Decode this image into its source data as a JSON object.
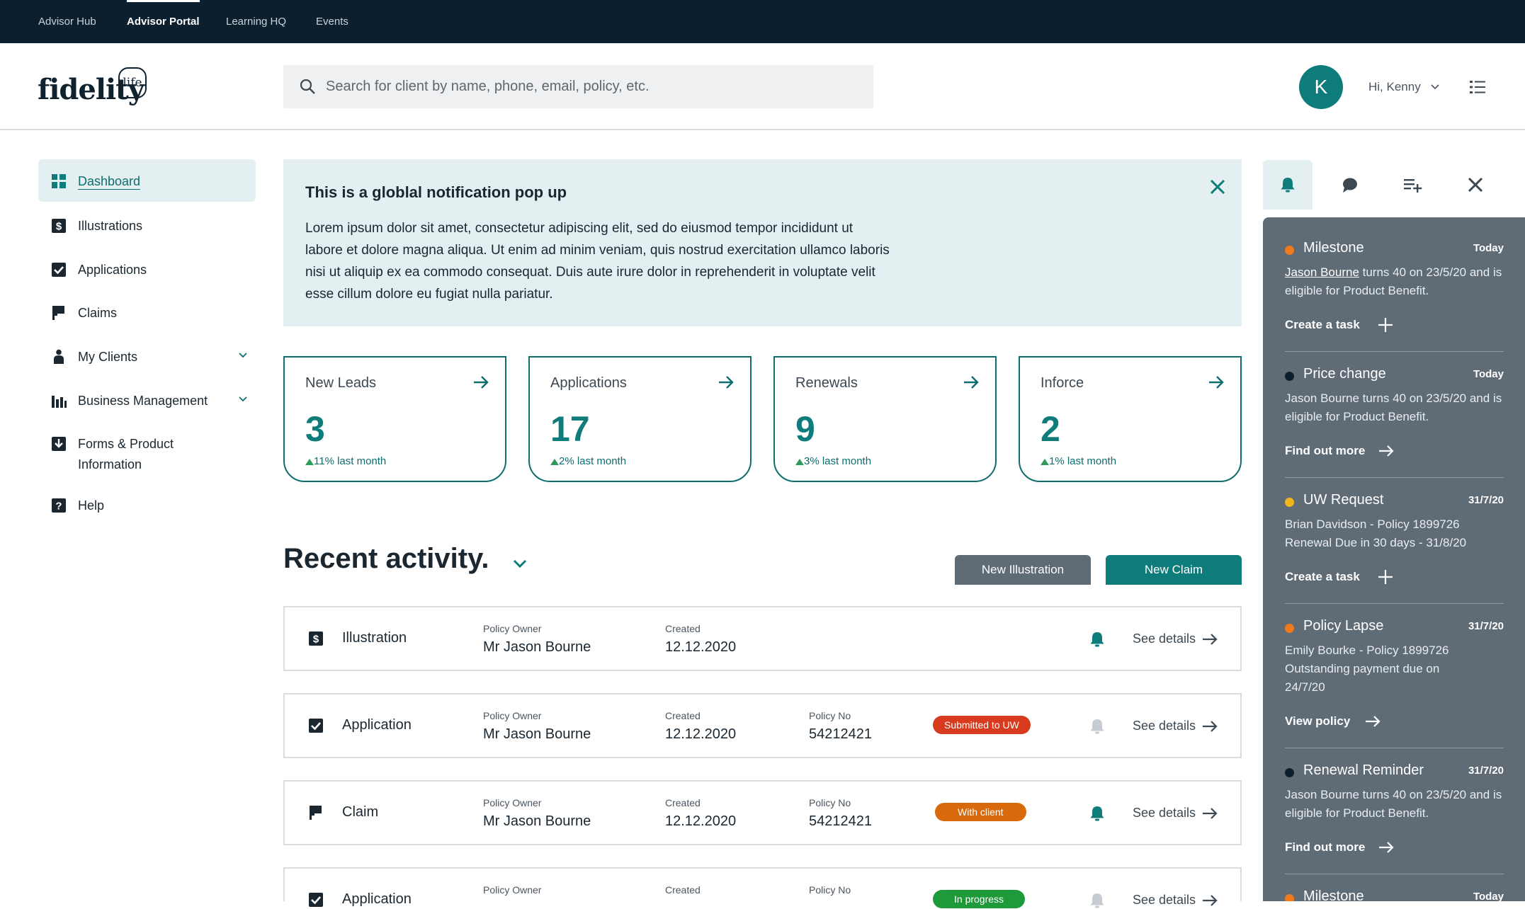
{
  "topnav": [
    {
      "label": "Advisor Hub",
      "active": false
    },
    {
      "label": "Advisor Portal",
      "active": true
    },
    {
      "label": "Learning HQ",
      "active": false
    },
    {
      "label": "Events",
      "active": false
    }
  ],
  "header": {
    "logo_text": "fidelity",
    "logo_badge": "life",
    "search_placeholder": "Search for client by name, phone, email, policy, etc.",
    "avatar_initial": "K",
    "greeting": "Hi, Kenny"
  },
  "sidebar": {
    "items": [
      {
        "label": "Dashboard",
        "icon": "dashboard-icon",
        "active": true
      },
      {
        "label": "Illustrations",
        "icon": "dollar-icon"
      },
      {
        "label": "Applications",
        "icon": "checkbox-icon"
      },
      {
        "label": "Claims",
        "icon": "flag-icon"
      },
      {
        "label": "My Clients",
        "icon": "person-icon",
        "expandable": true
      },
      {
        "label": "Business Management",
        "icon": "bar-chart-icon",
        "expandable": true
      },
      {
        "label": "Forms & Product",
        "label2": "Information",
        "icon": "download-icon"
      },
      {
        "label": "Help",
        "icon": "help-icon"
      }
    ]
  },
  "notification": {
    "title": "This is a globlal notification pop up",
    "body": "Lorem ipsum dolor sit amet, consectetur adipiscing elit, sed do eiusmod tempor incididunt ut labore et dolore magna aliqua. Ut enim ad minim veniam, quis nostrud exercitation ullamco laboris nisi ut aliquip ex ea commodo consequat. Duis aute irure dolor in reprehenderit in voluptate velit esse cillum dolore eu fugiat nulla pariatur."
  },
  "stats": [
    {
      "title": "New Leads",
      "value": "3",
      "trend": "11% last month"
    },
    {
      "title": "Applications",
      "value": "17",
      "trend": "2% last month"
    },
    {
      "title": "Renewals",
      "value": "9",
      "trend": "3% last month"
    },
    {
      "title": "Inforce",
      "value": "2",
      "trend": "1% last month"
    }
  ],
  "recent": {
    "title": "Recent activity.",
    "new_illustration": "New Illustration",
    "new_claim": "New Claim",
    "owner_label": "Policy Owner",
    "created_label": "Created",
    "policy_label": "Policy No",
    "details_label": "See details",
    "rows": [
      {
        "type": "Illustration",
        "icon": "dollar-icon",
        "owner": "Mr Jason Bourne",
        "created": "12.12.2020",
        "policy": "",
        "status": "",
        "status_color": "",
        "bell_active": true
      },
      {
        "type": "Application",
        "icon": "checkbox-icon",
        "owner": "Mr Jason Bourne",
        "created": "12.12.2020",
        "policy": "54212421",
        "status": "Submitted to UW",
        "status_color": "#d83a1e",
        "bell_active": false
      },
      {
        "type": "Claim",
        "icon": "flag-icon",
        "owner": "Mr Jason Bourne",
        "created": "12.12.2020",
        "policy": "54212421",
        "status": "With client",
        "status_color": "#d86a0c",
        "bell_active": true
      },
      {
        "type": "Application",
        "icon": "checkbox-icon",
        "owner": "",
        "created": "",
        "policy": "",
        "status": "In progress",
        "status_color": "#1f9a3a",
        "bell_active": false
      }
    ]
  },
  "feed": [
    {
      "title": "Milestone",
      "date": "Today",
      "dot": "#f07a1c",
      "link": "Jason Bourne",
      "body": " turns 40 on 23/5/20 and is eligible for Product Benefit.",
      "action": "Create a task",
      "action_icon": "plus-icon"
    },
    {
      "title": "Price change",
      "date": "Today",
      "dot": "#0b1f2e",
      "link": "",
      "body": "Jason Bourne turns 40 on 23/5/20 and is eligible for Product Benefit.",
      "action": "Find out more",
      "action_icon": "arrow-right-icon"
    },
    {
      "title": "UW Request",
      "date": "31/7/20",
      "dot": "#f2b51c",
      "link": "",
      "body": "Brian Davidson - Policy 1899726 Renewal Due in 30 days - 31/8/20",
      "action": "Create a task",
      "action_icon": "plus-icon"
    },
    {
      "title": "Policy Lapse",
      "date": "31/7/20",
      "dot": "#f07a1c",
      "link": "",
      "body": "Emily Bourke - Policy 1899726 Outstanding payment due on 24/7/20",
      "action": "View policy",
      "action_icon": "arrow-right-icon"
    },
    {
      "title": "Renewal Reminder",
      "date": "31/7/20",
      "dot": "#0b1f2e",
      "link": "",
      "body": "Jason Bourne turns 40 on 23/5/20 and is eligible for Product Benefit.",
      "action": "Find out more",
      "action_icon": "arrow-right-icon"
    },
    {
      "title": "Milestone",
      "date": "Today",
      "dot": "#f07a1c",
      "link": "",
      "body": "",
      "action": "",
      "action_icon": ""
    }
  ],
  "colors": {
    "brand": "#0e7c7b",
    "dark": "#0b1f2e",
    "panel": "#5f6b75",
    "tint": "#e3eff0"
  }
}
